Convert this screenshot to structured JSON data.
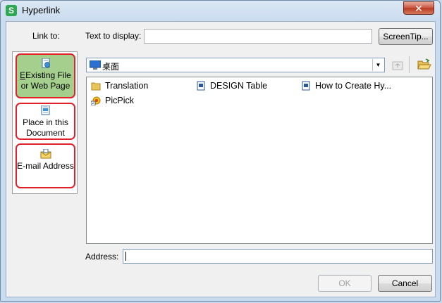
{
  "window": {
    "title": "Hyperlink",
    "close_symbol": "✕"
  },
  "header": {
    "link_to_label": "Link to:",
    "text_to_display_label": "Text to display:",
    "text_to_display_value": "",
    "screentip_button": "ScreenTip..."
  },
  "nav": {
    "existing_line1": "Existing File",
    "existing_line2": "or Web Page",
    "place_line1": "Place in this",
    "place_line2": "Document",
    "email_label": "E-mail Address"
  },
  "location": {
    "selected": "桌面"
  },
  "files": [
    {
      "name": "Translation",
      "icon": "folder-icon"
    },
    {
      "name": "DESIGN Table",
      "icon": "document-icon"
    },
    {
      "name": "How to Create Hy...",
      "icon": "document-icon"
    },
    {
      "name": "PicPick",
      "icon": "shortcut-icon"
    }
  ],
  "address": {
    "label": "Address:",
    "value": ""
  },
  "footer": {
    "ok_label": "OK",
    "cancel_label": "Cancel"
  },
  "colors": {
    "selected_nav": "#a4cf8c",
    "highlight_outline": "#e0202a",
    "app_icon": "#2fa853"
  }
}
